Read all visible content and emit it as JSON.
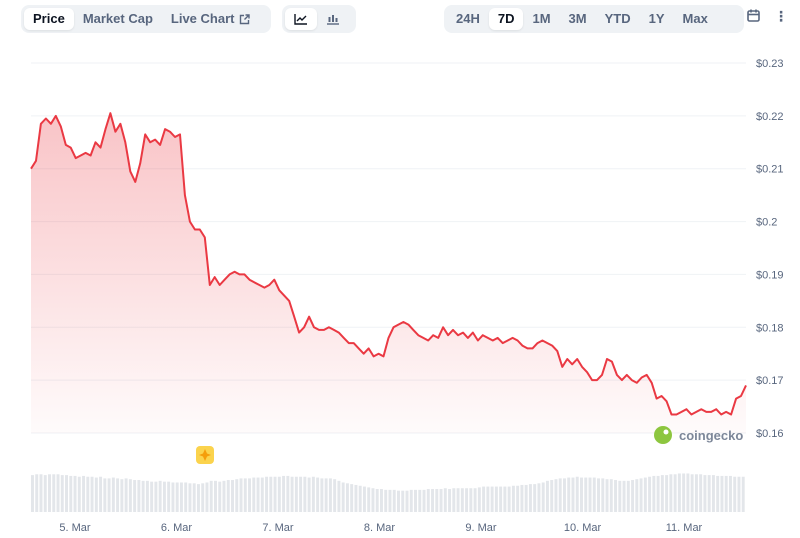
{
  "toolbar": {
    "chart_type_tabs": [
      {
        "label": "Price",
        "active": true
      },
      {
        "label": "Market Cap",
        "active": false
      },
      {
        "label": "Live Chart",
        "active": false
      }
    ],
    "view_icons": [
      "line-chart-icon",
      "candlestick-icon"
    ],
    "ranges": [
      {
        "label": "24H",
        "active": false
      },
      {
        "label": "7D",
        "active": true
      },
      {
        "label": "1M",
        "active": false
      },
      {
        "label": "3M",
        "active": false
      },
      {
        "label": "YTD",
        "active": false
      },
      {
        "label": "1Y",
        "active": false
      },
      {
        "label": "Max",
        "active": false
      }
    ],
    "calendar_icon": "calendar-icon",
    "more_label": "⋮"
  },
  "watermark": "coingecko",
  "colors": {
    "line": "#ea3943",
    "fill": "#ea3943",
    "volume": "#e3e6ea",
    "grid": "#eff2f5",
    "accent_toolbar": "#eff2f5"
  },
  "chart_data": {
    "type": "area",
    "series": [
      {
        "values": [
          0.21,
          0.2115,
          0.2185,
          0.2195,
          0.2185,
          0.22,
          0.218,
          0.2145,
          0.214,
          0.212,
          0.2125,
          0.213,
          0.2125,
          0.215,
          0.214,
          0.2175,
          0.2205,
          0.217,
          0.2185,
          0.215,
          0.2095,
          0.2075,
          0.211,
          0.2165,
          0.215,
          0.2155,
          0.2145,
          0.2175,
          0.217,
          0.216,
          0.2165,
          0.205,
          0.2,
          0.1985,
          0.1985,
          0.197,
          0.188,
          0.1895,
          0.188,
          0.189,
          0.19,
          0.1905,
          0.19,
          0.19,
          0.189,
          0.1885,
          0.188,
          0.1875,
          0.188,
          0.189,
          0.187,
          0.186,
          0.185,
          0.182,
          0.179,
          0.18,
          0.182,
          0.18,
          0.1795,
          0.1795,
          0.18,
          0.1795,
          0.179,
          0.178,
          0.177,
          0.177,
          0.176,
          0.175,
          0.176,
          0.1745,
          0.175,
          0.1745,
          0.178,
          0.18,
          0.1805,
          0.181,
          0.1805,
          0.1795,
          0.1785,
          0.178,
          0.1775,
          0.1785,
          0.178,
          0.18,
          0.1785,
          0.1795,
          0.1785,
          0.179,
          0.178,
          0.179,
          0.1775,
          0.1785,
          0.178,
          0.1775,
          0.178,
          0.177,
          0.1775,
          0.178,
          0.1775,
          0.1765,
          0.176,
          0.176,
          0.177,
          0.1775,
          0.177,
          0.1765,
          0.1755,
          0.1725,
          0.174,
          0.173,
          0.174,
          0.1725,
          0.1715,
          0.17,
          0.17,
          0.171,
          0.174,
          0.1735,
          0.171,
          0.17,
          0.171,
          0.17,
          0.1695,
          0.1705,
          0.171,
          0.1695,
          0.1665,
          0.167,
          0.166,
          0.1635,
          0.1635,
          0.164,
          0.1645,
          0.1635,
          0.164,
          0.1645,
          0.164,
          0.164,
          0.1645,
          0.1635,
          0.164,
          0.1635,
          0.1665,
          0.167,
          0.169
        ]
      }
    ],
    "volume": [
      0.45,
      0.46,
      0.46,
      0.45,
      0.46,
      0.46,
      0.46,
      0.45,
      0.45,
      0.44,
      0.44,
      0.43,
      0.44,
      0.43,
      0.43,
      0.42,
      0.43,
      0.41,
      0.41,
      0.42,
      0.41,
      0.4,
      0.41,
      0.4,
      0.39,
      0.39,
      0.38,
      0.38,
      0.37,
      0.37,
      0.38,
      0.37,
      0.37,
      0.36,
      0.36,
      0.36,
      0.36,
      0.35,
      0.35,
      0.34,
      0.35,
      0.36,
      0.38,
      0.38,
      0.37,
      0.38,
      0.39,
      0.39,
      0.4,
      0.41,
      0.41,
      0.41,
      0.42,
      0.42,
      0.42,
      0.43,
      0.43,
      0.43,
      0.43,
      0.44,
      0.44,
      0.43,
      0.43,
      0.43,
      0.43,
      0.42,
      0.43,
      0.42,
      0.41,
      0.41,
      0.41,
      0.4,
      0.38,
      0.36,
      0.35,
      0.34,
      0.33,
      0.32,
      0.31,
      0.3,
      0.29,
      0.28,
      0.28,
      0.27,
      0.27,
      0.27,
      0.26,
      0.26,
      0.26,
      0.27,
      0.27,
      0.27,
      0.27,
      0.28,
      0.28,
      0.28,
      0.28,
      0.29,
      0.28,
      0.29,
      0.29,
      0.29,
      0.29,
      0.29,
      0.29,
      0.3,
      0.31,
      0.31,
      0.31,
      0.31,
      0.31,
      0.31,
      0.31,
      0.32,
      0.32,
      0.33,
      0.33,
      0.34,
      0.34,
      0.35,
      0.36,
      0.38,
      0.39,
      0.4,
      0.41,
      0.41,
      0.42,
      0.42,
      0.43,
      0.42,
      0.42,
      0.42,
      0.42,
      0.41,
      0.41,
      0.4,
      0.4,
      0.39,
      0.38,
      0.38,
      0.38,
      0.39,
      0.4,
      0.41,
      0.42,
      0.43,
      0.44,
      0.44,
      0.45,
      0.45,
      0.46,
      0.46,
      0.47,
      0.47,
      0.47,
      0.46,
      0.46,
      0.46,
      0.45,
      0.45,
      0.45,
      0.44,
      0.44,
      0.44,
      0.44,
      0.43,
      0.43,
      0.43
    ],
    "x_ticks": [
      "5. Mar",
      "6. Mar",
      "7. Mar",
      "8. Mar",
      "9. Mar",
      "10. Mar",
      "11. Mar"
    ],
    "y_ticks": [
      "$0.23",
      "$0.22",
      "$0.21",
      "$0.2",
      "$0.19",
      "$0.18",
      "$0.17",
      "$0.16"
    ],
    "y_tick_values": [
      0.23,
      0.22,
      0.21,
      0.2,
      0.19,
      0.18,
      0.17,
      0.16
    ],
    "ylim": [
      0.16,
      0.23
    ],
    "grid": true,
    "event_marker": {
      "icon": "sparkle-icon"
    }
  }
}
